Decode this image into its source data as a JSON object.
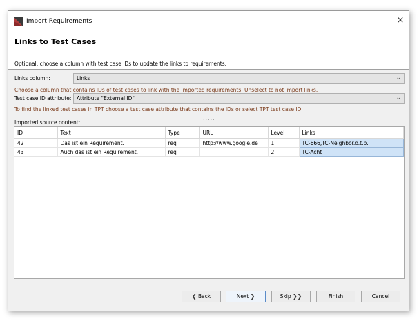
{
  "window": {
    "title": "Import Requirements",
    "close_icon": "×"
  },
  "header": {
    "title": "Links to Test Cases",
    "description": "Optional: choose a column with test case IDs to update the links to requirements."
  },
  "links_column": {
    "label": "Links column:",
    "value": "Links",
    "hint": "Choose a column that contains IDs of test cases to link with the imported requirements. Unselect to not import links."
  },
  "test_case_attribute": {
    "label": "Test case ID attribute:",
    "value": "Attribute \"External ID\"",
    "hint": "To find the linked test cases in TPT choose a test case attribute that contains the IDs or select TPT test case ID."
  },
  "grip": ".....",
  "source": {
    "label": "Imported source content:",
    "columns": [
      "ID",
      "Text",
      "Type",
      "URL",
      "Level",
      "Links"
    ],
    "rows": [
      [
        "42",
        "Das ist ein Requirement.",
        "req",
        "http://www.google.de",
        "1",
        "TC-666,TC-Neighbor.o.t.b."
      ],
      [
        "43",
        "Auch das ist ein Requirement.",
        "req",
        "",
        "2",
        "TC-Acht"
      ]
    ]
  },
  "buttons": {
    "back": "Back",
    "back_icon": "❮",
    "next": "Next",
    "next_icon": "❯",
    "skip": "Skip",
    "skip_icon": "❯❯",
    "finish": "Finish",
    "cancel": "Cancel"
  },
  "colors": {
    "hint_text": "#7a3a1a",
    "selection": "#cfe3f7"
  }
}
